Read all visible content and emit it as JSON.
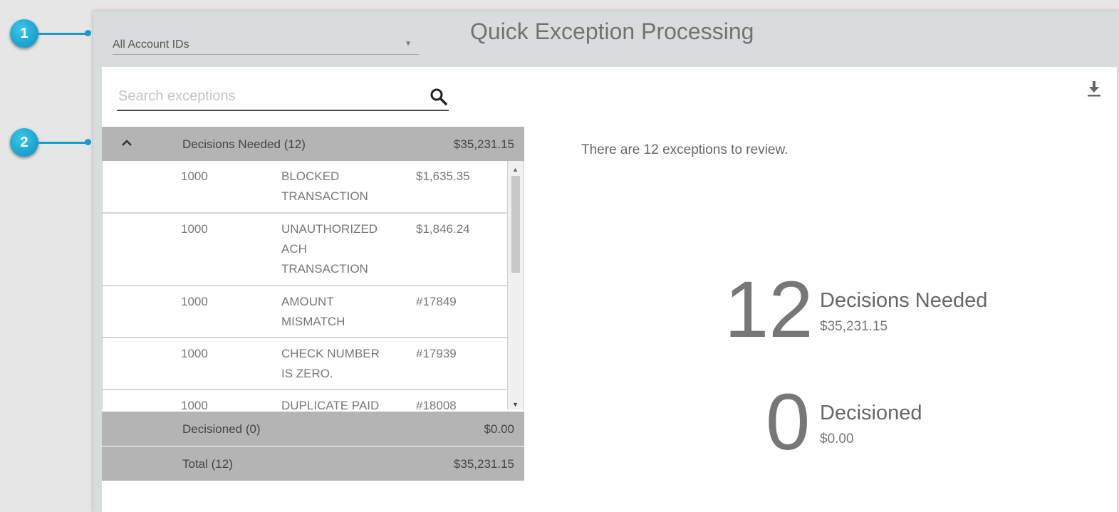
{
  "callouts": [
    "1",
    "2"
  ],
  "header": {
    "account_select": "All Account IDs",
    "title": "Quick Exception Processing"
  },
  "search": {
    "placeholder": "Search exceptions"
  },
  "icons": {
    "search": "search-icon",
    "download": "download-icon",
    "collapse": "chevron-up-icon",
    "scroll_up": "scroll-up-arrow",
    "scroll_down": "scroll-down-arrow",
    "dropdown": "caret-down-icon"
  },
  "decisions_needed_group": {
    "label": "Decisions Needed (12)",
    "amount": "$35,231.15"
  },
  "exceptions": [
    {
      "account": "1000",
      "description": "BLOCKED TRANSACTION",
      "amount": "$1,635.35"
    },
    {
      "account": "1000",
      "description": "UNAUTHORIZED ACH TRANSACTION",
      "amount": "$1,846.24"
    },
    {
      "account": "1000",
      "description": "AMOUNT MISMATCH",
      "amount": "#17849"
    },
    {
      "account": "1000",
      "description": "CHECK NUMBER IS ZERO.",
      "amount": "#17939"
    },
    {
      "account": "1000",
      "description": "DUPLICATE PAID",
      "amount": "#18008"
    }
  ],
  "decisioned_group": {
    "label": "Decisioned (0)",
    "amount": "$0.00"
  },
  "total_group": {
    "label": "Total (12)",
    "amount": "$35,231.15"
  },
  "review_message": "There are 12 exceptions to review.",
  "stats": {
    "needed": {
      "count": "12",
      "label": "Decisions Needed",
      "amount": "$35,231.15"
    },
    "decisioned": {
      "count": "0",
      "label": "Decisioned",
      "amount": "$0.00"
    }
  },
  "colors": {
    "callout": "#1a9cc9",
    "header_bg": "#d9dcdc",
    "group_bg": "#b4b4b4"
  }
}
